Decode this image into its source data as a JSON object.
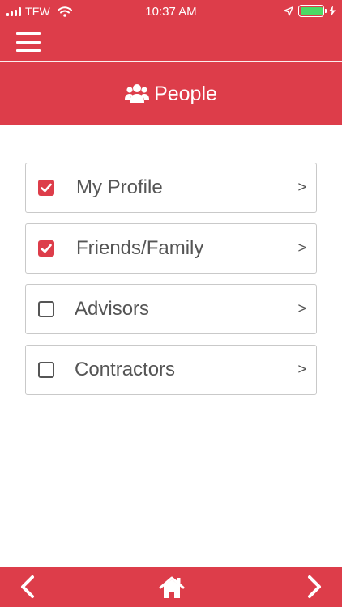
{
  "status_bar": {
    "carrier": "TFW",
    "time": "10:37 AM"
  },
  "header": {
    "title": "People",
    "title_icon": "people-icon"
  },
  "items": [
    {
      "label": "My Profile",
      "checked": true,
      "chevron": ">"
    },
    {
      "label": "Friends/Family",
      "checked": true,
      "chevron": ">"
    },
    {
      "label": "Advisors",
      "checked": false,
      "chevron": ">"
    },
    {
      "label": "Contractors",
      "checked": false,
      "chevron": ">"
    }
  ],
  "bottom_nav": {
    "back_icon": "chevron-left-icon",
    "home_icon": "home-icon",
    "forward_icon": "chevron-right-icon"
  },
  "colors": {
    "brand_red": "#dd3d4a",
    "battery_green": "#4cd964"
  }
}
